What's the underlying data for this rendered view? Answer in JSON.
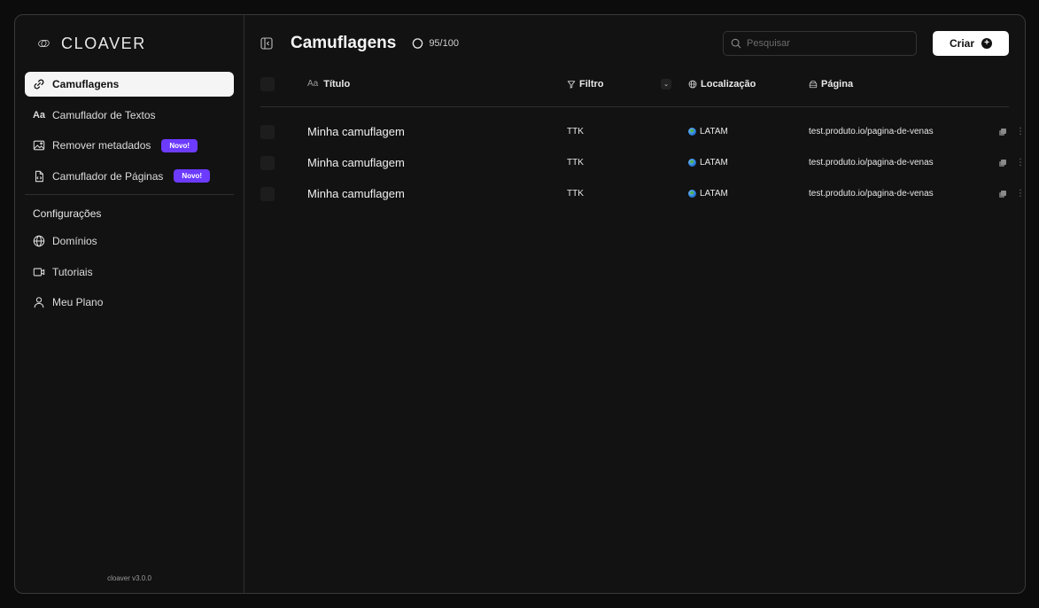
{
  "sidebar": {
    "logo_text": "CLOAVER",
    "items": [
      {
        "label": "Camuflagens",
        "icon": "link-icon",
        "active": true
      },
      {
        "label": "Camuflador de Textos",
        "icon": "text-aa-icon"
      },
      {
        "label": "Remover metadados",
        "icon": "image-icon",
        "badge": "Novo!"
      },
      {
        "label": "Camuflador de Páginas",
        "icon": "file-code-icon",
        "badge": "Novo!"
      }
    ],
    "aa_glyph": "Aa",
    "section_title": "Configurações",
    "settings_items": [
      {
        "label": "Domínios",
        "icon": "globe-icon"
      },
      {
        "label": "Tutoriais",
        "icon": "video-icon"
      },
      {
        "label": "Meu Plano",
        "icon": "user-icon"
      }
    ],
    "version": "cloaver v3.0.0"
  },
  "header": {
    "title": "Camuflagens",
    "counter": "95/100",
    "search_placeholder": "Pesquisar",
    "create_label": "Criar"
  },
  "table": {
    "columns": {
      "title_prefix": "Aa",
      "title": "Título",
      "filter": "Filtro",
      "location": "Localização",
      "page": "Página"
    },
    "rows": [
      {
        "title": "Minha camuflagem",
        "filter": "TTK",
        "location": "LATAM",
        "page": "test.produto.io/pagina-de-venas"
      },
      {
        "title": "Minha camuflagem",
        "filter": "TTK",
        "location": "LATAM",
        "page": "test.produto.io/pagina-de-venas"
      },
      {
        "title": "Minha camuflagem",
        "filter": "TTK",
        "location": "LATAM",
        "page": "test.produto.io/pagina-de-venas"
      }
    ]
  },
  "colors": {
    "background": "#121212",
    "accent_badge": "#6c3bff",
    "active_item": "#f5f5f5"
  }
}
